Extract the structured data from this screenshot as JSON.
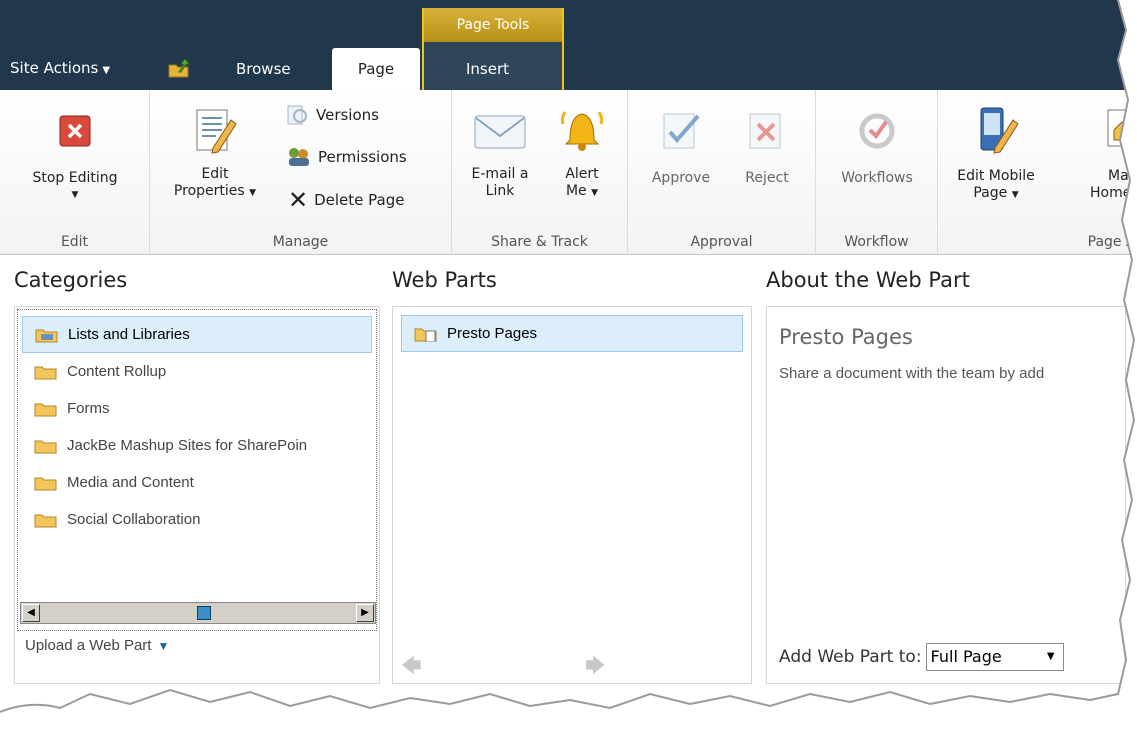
{
  "topbar": {
    "site_actions": "Site Actions",
    "tabs": {
      "browse": "Browse",
      "page": "Page",
      "insert": "Insert"
    },
    "contextual_header": "Page Tools"
  },
  "ribbon": {
    "edit": {
      "group": "Edit",
      "stop_editing": "Stop Editing"
    },
    "manage": {
      "group": "Manage",
      "edit_properties_1": "Edit",
      "edit_properties_2": "Properties",
      "versions": "Versions",
      "permissions": "Permissions",
      "delete_page": "Delete Page"
    },
    "share": {
      "group": "Share & Track",
      "email_1": "E-mail a",
      "email_2": "Link",
      "alert_1": "Alert",
      "alert_2": "Me"
    },
    "approval": {
      "group": "Approval",
      "approve": "Approve",
      "reject": "Reject"
    },
    "workflow": {
      "group": "Workflow",
      "workflows": "Workflows"
    },
    "page_actions": {
      "group": "Page Ac",
      "edit_mobile_1": "Edit Mobile",
      "edit_mobile_2": "Page",
      "make_home_1": "Ma",
      "make_home_2": "Home"
    }
  },
  "categories": {
    "title": "Categories",
    "items": [
      {
        "label": "Lists and Libraries",
        "selected": true
      },
      {
        "label": "Content Rollup"
      },
      {
        "label": "Forms"
      },
      {
        "label": "JackBe Mashup Sites for SharePoin"
      },
      {
        "label": "Media and Content"
      },
      {
        "label": "Social Collaboration"
      }
    ],
    "upload": "Upload a Web Part"
  },
  "webparts": {
    "title": "Web Parts",
    "items": [
      {
        "label": "Presto Pages",
        "selected": true
      }
    ]
  },
  "about": {
    "title": "About the Web Part",
    "name": "Presto Pages",
    "description": "Share a document with the team by add",
    "add_to_label": "Add Web Part to:",
    "add_to_value": "Full Page"
  },
  "colors": {
    "topbar": "#21374c",
    "contextual": "#f0c419",
    "selection": "#ddeefb"
  }
}
